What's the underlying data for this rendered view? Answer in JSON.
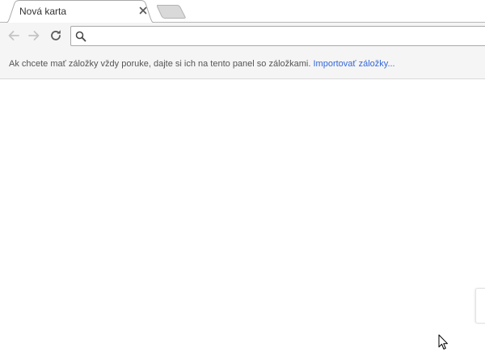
{
  "tabs": [
    {
      "title": "Nová karta",
      "active": true
    }
  ],
  "toolbar": {
    "back_label": "Späť",
    "forward_label": "Dopredu",
    "reload_label": "Znova načítať",
    "omnibox_value": "",
    "omnibox_placeholder": ""
  },
  "bookmarks_bar": {
    "message": "Ak chcete mať záložky vždy poruke, dajte si ich na tento panel so záložkami.",
    "import_link": "Importovať záložky..."
  },
  "colors": {
    "link": "#3367d6",
    "toolbar_bg": "#f5f5f5"
  }
}
